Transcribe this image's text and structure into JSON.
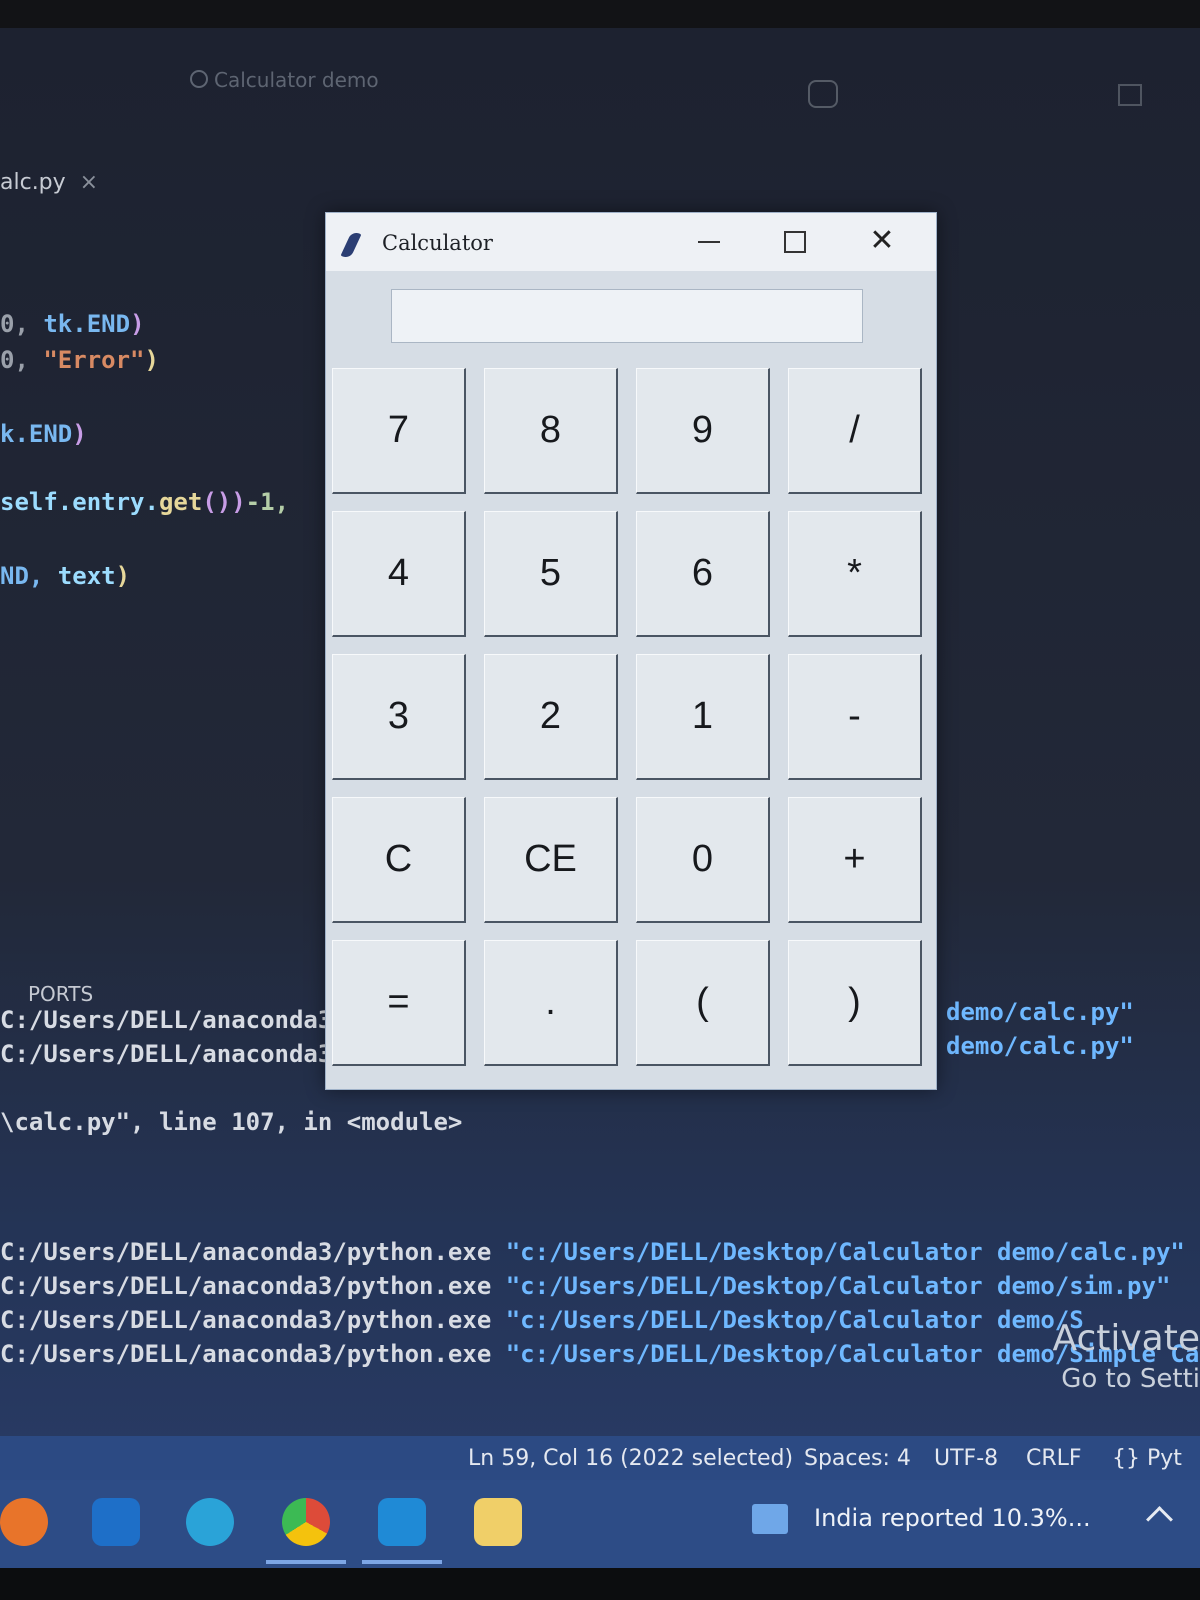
{
  "desktop": {
    "title_search": "Calculator demo",
    "editor_tab": "alc.py",
    "editor_tab_close": "×",
    "code": {
      "line1_a": "0, ",
      "line1_b": "tk.END",
      "line1_c": ")",
      "line2_a": "0, ",
      "line2_b": "\"Error\"",
      "line2_c": ")",
      "line3_a": "k.END",
      "line3_b": ")",
      "line4_a": "self.entry.",
      "line4_b": "get",
      "line4_c": "())",
      "line4_d": "-1,",
      "line5_a": "ND, ",
      "line5_b": "text",
      "line5_c": ")"
    },
    "ports_label": "PORTS",
    "terminal": {
      "line1": "C:/Users/DELL/anaconda3/",
      "line2": "C:/Users/DELL/anaconda3/",
      "line1_right": "demo/calc.py\"",
      "line2_right": "demo/calc.py\"",
      "traceback": "\\calc.py\", line 107, in <module>",
      "runs": [
        {
          "exe": "C:/Users/DELL/anaconda3/python.exe ",
          "arg": "\"c:/Users/DELL/Desktop/Calculator demo/calc.py\""
        },
        {
          "exe": "C:/Users/DELL/anaconda3/python.exe ",
          "arg": "\"c:/Users/DELL/Desktop/Calculator demo/sim.py\""
        },
        {
          "exe": "C:/Users/DELL/anaconda3/python.exe ",
          "arg": "\"c:/Users/DELL/Desktop/Calculator demo/S"
        },
        {
          "exe": "C:/Users/DELL/anaconda3/python.exe ",
          "arg": "\"c:/Users/DELL/Desktop/Calculator demo/Simple Calc"
        }
      ]
    },
    "watermark": {
      "activate": "Activate",
      "goto": "Go to Setti"
    },
    "statusbar": {
      "position": "Ln 59, Col 16 (2022 selected)",
      "spaces": "Spaces: 4",
      "encoding": "UTF-8",
      "eol": "CRLF",
      "language": "{} Pyt"
    },
    "taskbar": {
      "icons": [
        "firefox-icon",
        "outlook-icon",
        "edge-icon",
        "chrome-icon",
        "vscode-icon",
        "file-explorer-icon"
      ],
      "news": "India reported 10.3%..."
    }
  },
  "calculator": {
    "title": "Calculator",
    "close_glyph": "✕",
    "entry_value": "",
    "buttons": [
      [
        "7",
        "8",
        "9",
        "/"
      ],
      [
        "4",
        "5",
        "6",
        "*"
      ],
      [
        "3",
        "2",
        "1",
        "-"
      ],
      [
        "C",
        "CE",
        "0",
        "+"
      ],
      [
        "=",
        ".",
        "(",
        ")"
      ]
    ]
  },
  "colors": {
    "calculator_bg": "#d6dde5",
    "button_face": "#e3e8ed",
    "statusbar": "#2c4a83",
    "terminal_path": "#6fb8ff"
  }
}
